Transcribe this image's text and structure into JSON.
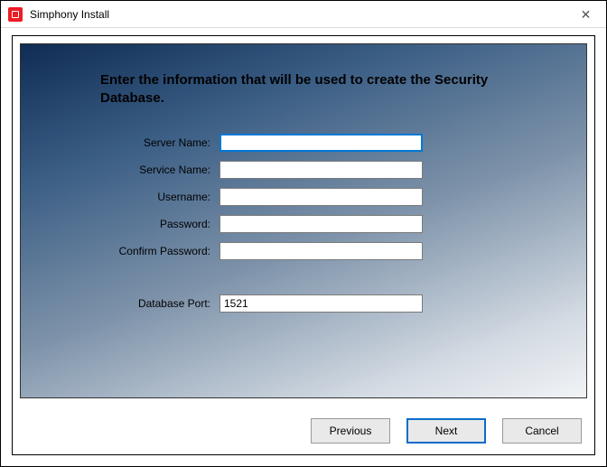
{
  "window": {
    "title": "Simphony Install"
  },
  "heading": "Enter the information that will be used to create the Security Database.",
  "fields": {
    "server_name": {
      "label": "Server Name:",
      "value": ""
    },
    "service_name": {
      "label": "Service Name:",
      "value": ""
    },
    "username": {
      "label": "Username:",
      "value": ""
    },
    "password": {
      "label": "Password:",
      "value": ""
    },
    "confirm_password": {
      "label": "Confirm Password:",
      "value": ""
    },
    "database_port": {
      "label": "Database Port:",
      "value": "1521"
    }
  },
  "buttons": {
    "previous": "Previous",
    "next": "Next",
    "cancel": "Cancel"
  }
}
